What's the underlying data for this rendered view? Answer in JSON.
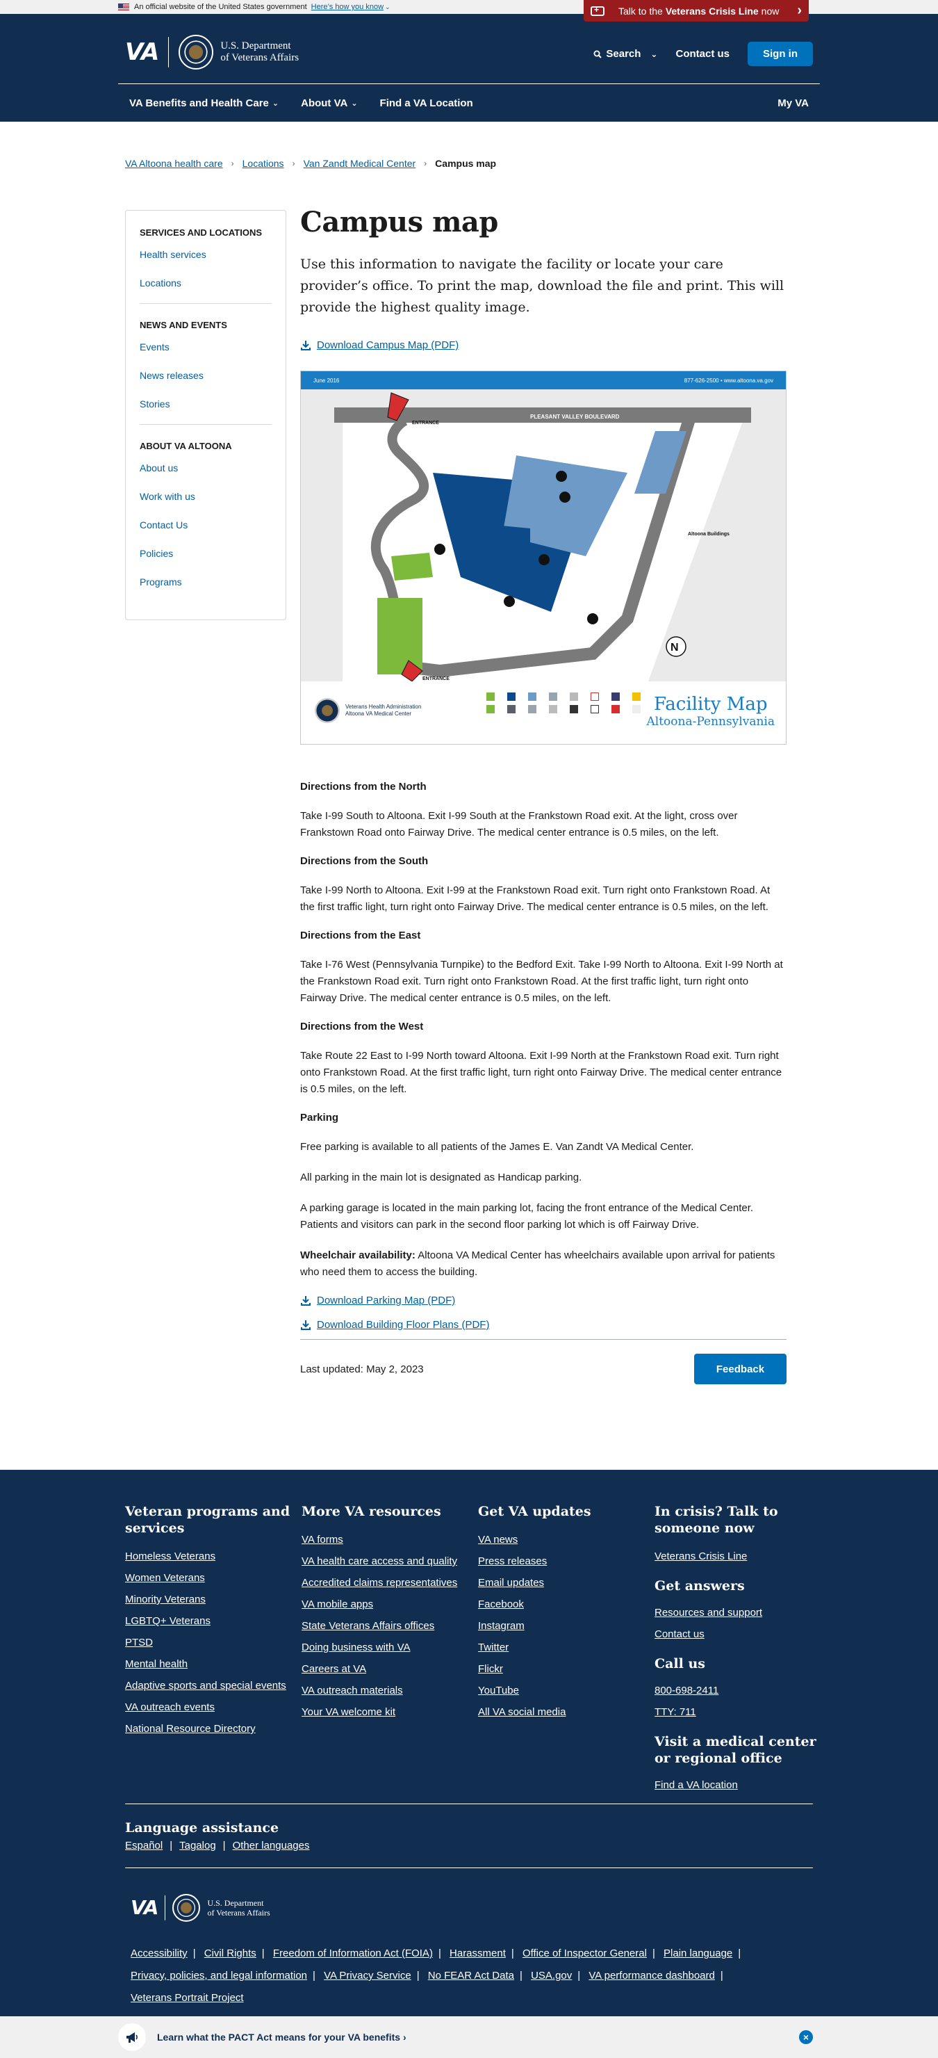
{
  "gov_banner": {
    "text": "An official website of the United States government",
    "link": "Here’s how you know"
  },
  "crisis": {
    "pre": "Talk to the",
    "bold": "Veterans Crisis Line",
    "post": "now"
  },
  "header": {
    "logo_va": "VA",
    "logo_line1": "U.S. Department",
    "logo_line2": "of Veterans Affairs",
    "search": "Search",
    "contact": "Contact us",
    "sign_in": "Sign in"
  },
  "nav": {
    "items": [
      "VA Benefits and Health Care",
      "About VA",
      "Find a VA Location"
    ],
    "my_va": "My VA"
  },
  "breadcrumb": [
    "VA Altoona health care",
    "Locations",
    "Van Zandt Medical Center",
    "Campus map"
  ],
  "sidebar": {
    "section1": "SERVICES AND LOCATIONS",
    "section1_items": [
      "Health services",
      "Locations"
    ],
    "section2": "NEWS AND EVENTS",
    "section2_items": [
      "Events",
      "News releases",
      "Stories"
    ],
    "section3": "ABOUT VA ALTOONA",
    "section3_items": [
      "About us",
      "Work with us",
      "Contact Us",
      "Policies",
      "Programs"
    ]
  },
  "page": {
    "title": "Campus map",
    "lead": "Use this information to navigate the facility or locate your care provider’s office. To print the map, download the file and print. This will provide the highest quality image.",
    "download_campus": "Download Campus Map (PDF)",
    "map": {
      "top_left": "June 2016",
      "top_right": "877-626-2500 • www.altoona.va.gov",
      "road_label": "PLEASANT VALLEY BOULEVARD",
      "entrance": "ENTRANCE",
      "vha_line1": "Veterans Health Administration",
      "vha_line2": "Altoona VA Medical Center",
      "title1": "Facility Map",
      "title2": "Altoona-Pennsylvania",
      "legend_title": "Altoona Buildings"
    },
    "directions": [
      {
        "heading": "Directions from the North",
        "text": "Take I-99 South to Altoona.  Exit I-99 South at the Frankstown Road exit.  At the light, cross over Frankstown Road onto Fairway Drive. The medical center entrance is 0.5 miles, on the left."
      },
      {
        "heading": "Directions from the South",
        "text": "Take I-99 North to Altoona. Exit I-99 at the Frankstown Road exit.  Turn right onto Frankstown Road.  At the first traffic light, turn right onto Fairway Drive.  The medical center entrance is 0.5 miles, on the left."
      },
      {
        "heading": "Directions from the East",
        "text": "Take I-76 West (Pennsylvania Turnpike) to the Bedford Exit.  Take I-99 North to Altoona.  Exit I-99 North at the Frankstown Road exit. Turn right onto Frankstown Road.  At the first traffic light, turn right onto Fairway Drive.  The medical center entrance is 0.5 miles, on the left."
      },
      {
        "heading": "Directions from the West",
        "text": "Take Route 22 East to I-99 North toward Altoona. Exit I-99 North at the Frankstown Road exit. Turn right onto Frankstown Road. At the first traffic light, turn right onto Fairway Drive. The medical center entrance is 0.5 miles, on the left."
      }
    ],
    "parking_heading": "Parking",
    "parking": [
      "Free parking is available to all patients of the James E. Van Zandt VA Medical Center.",
      "All parking in the main lot is designated as Handicap parking.",
      "A parking garage is located in the main parking lot, facing the front entrance of the Medical Center. Patients and visitors can park in the second floor parking lot which is off Fairway Drive."
    ],
    "wheelchair_label": "Wheelchair availability:",
    "wheelchair_text": "Altoona VA Medical Center has wheelchairs available upon arrival for patients who need them to access the building.",
    "download_parking": "Download Parking Map (PDF)",
    "download_floor": "Download Building Floor Plans (PDF)",
    "last_updated": "Last updated: May 2, 2023",
    "feedback": "Feedback"
  },
  "footer": {
    "col1_title": "Veteran programs and services",
    "col1": [
      "Homeless Veterans",
      "Women Veterans",
      "Minority Veterans",
      "LGBTQ+ Veterans",
      "PTSD",
      "Mental health",
      "Adaptive sports and special events",
      "VA outreach events",
      "National Resource Directory"
    ],
    "col2_title": "More VA resources",
    "col2": [
      "VA forms",
      "VA health care access and quality",
      "Accredited claims representatives",
      "VA mobile apps",
      "State Veterans Affairs offices",
      "Doing business with VA",
      "Careers at VA",
      "VA outreach materials",
      "Your VA welcome kit"
    ],
    "col3_title": "Get VA updates",
    "col3": [
      "VA news",
      "Press releases",
      "Email updates",
      "Facebook",
      "Instagram",
      "Twitter",
      "Flickr",
      "YouTube",
      "All VA social media"
    ],
    "col4_title": "In crisis? Talk to someone now",
    "col4_crisis": "Veterans Crisis Line",
    "col4_answers_title": "Get answers",
    "col4_answers": [
      "Resources and support",
      "Contact us"
    ],
    "col4_call_title": "Call us",
    "col4_call": [
      "800-698-2411",
      "TTY: 711"
    ],
    "col4_visit_title": "Visit a medical center or regional office",
    "col4_visit": "Find a VA location",
    "lang_title": "Language assistance",
    "lang": [
      "Español",
      "Tagalog",
      "Other languages"
    ],
    "legal": [
      "Accessibility",
      "Civil Rights",
      "Freedom of Information Act (FOIA)",
      "Harassment",
      "Office of Inspector General",
      "Plain language",
      "Privacy, policies, and legal information",
      "VA Privacy Service",
      "No FEAR Act Data",
      "USA.gov",
      "VA performance dashboard",
      "Veterans Portrait Project"
    ]
  },
  "promo": {
    "text": "Learn what the PACT Act means for your VA benefits ›"
  }
}
